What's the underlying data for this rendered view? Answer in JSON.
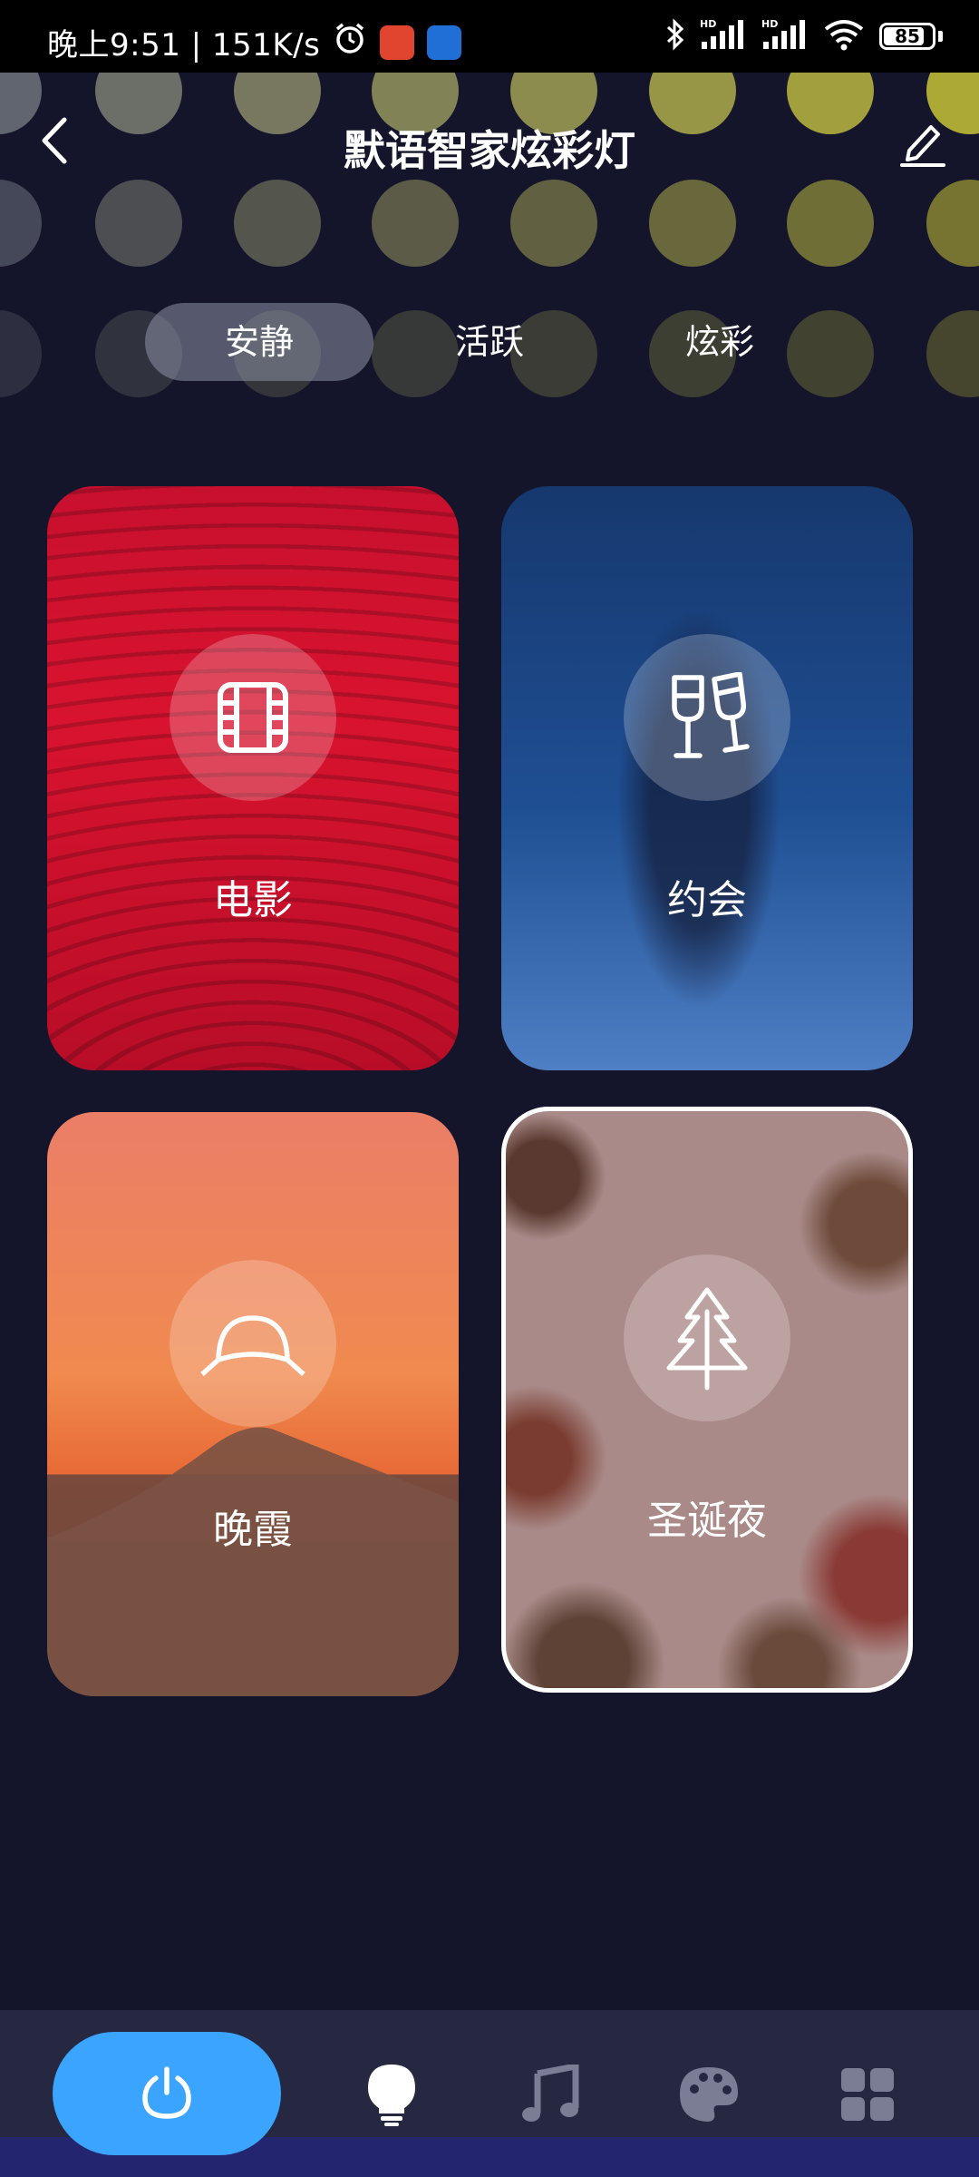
{
  "status_bar": {
    "time_text": "晚上9:51 | 151K/s",
    "battery": "85",
    "icons": [
      "alarm-icon",
      "app-icon-1",
      "app-icon-2",
      "bluetooth-icon",
      "signal-hd-icon",
      "signal-hd-icon",
      "wifi-icon",
      "battery-icon"
    ]
  },
  "header": {
    "title": "默语智家炫彩灯",
    "back_icon": "chevron-left-icon",
    "edit_icon": "pencil-icon"
  },
  "tabs": [
    {
      "label": "安静",
      "active": true
    },
    {
      "label": "活跃",
      "active": false
    },
    {
      "label": "炫彩",
      "active": false
    }
  ],
  "scenes": [
    {
      "label": "电影",
      "icon": "film-icon",
      "selected": false
    },
    {
      "label": "约会",
      "icon": "wine-glasses-icon",
      "selected": false
    },
    {
      "label": "晚霞",
      "icon": "sunset-icon",
      "selected": false
    },
    {
      "label": "圣诞夜",
      "icon": "christmas-tree-icon",
      "selected": true
    }
  ],
  "bottom_nav": [
    {
      "icon": "power-icon",
      "active": true
    },
    {
      "icon": "bulb-icon",
      "active": false
    },
    {
      "icon": "music-note-icon",
      "active": false
    },
    {
      "icon": "palette-icon",
      "active": false
    },
    {
      "icon": "grid-icon",
      "active": false
    }
  ],
  "colors": {
    "background": "#14152a",
    "accent": "#3aa4ff",
    "nav_bg": "#262842"
  }
}
